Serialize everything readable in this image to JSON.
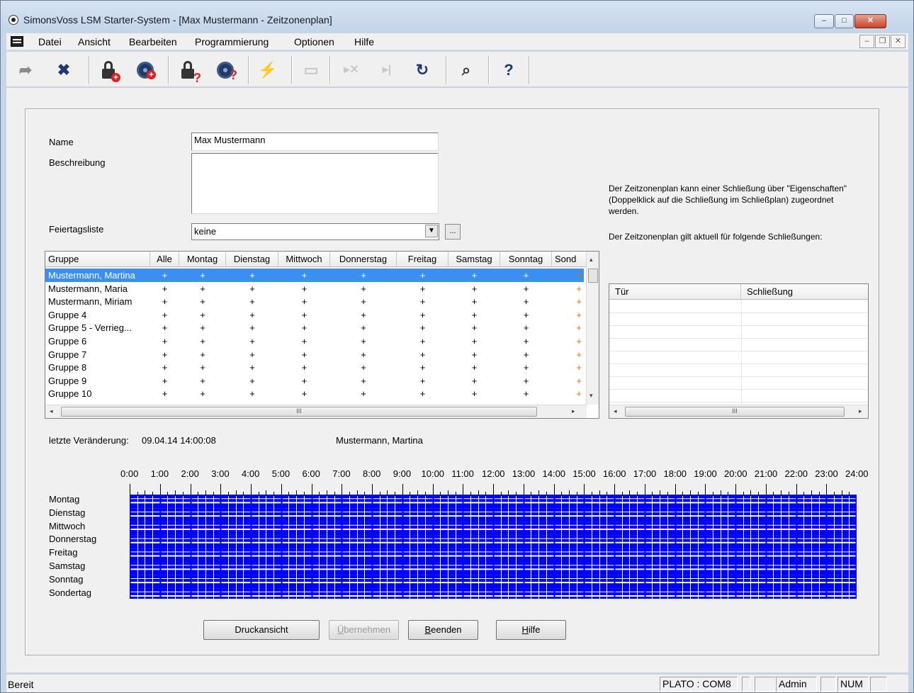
{
  "window": {
    "title": "SimonsVoss LSM Starter-System - [Max Mustermann - Zeitzonenplan]",
    "min_label": "–",
    "max_label": "□",
    "close_label": "✕"
  },
  "menu": {
    "items": [
      "Datei",
      "Ansicht",
      "Bearbeiten",
      "Programmierung",
      "Optionen",
      "Hilfe"
    ],
    "mdi_min": "–",
    "mdi_restore": "❐",
    "mdi_close": "✕"
  },
  "toolbar": {
    "icons": [
      "arrow-right-icon",
      "cross-arrows-icon",
      "add-lock-icon",
      "add-transponder-icon",
      "lock-query-icon",
      "transponder-query-icon",
      "lightning-icon",
      "save-icon",
      "delete-icon",
      "insert-icon",
      "refresh-icon",
      "search-icon",
      "help-icon"
    ],
    "arrow_glyph": "➦",
    "cross_glyph": "✖",
    "lightning_glyph": "⚡",
    "save_glyph": "▭",
    "delete_glyph": "▸✕",
    "insert_glyph": "▸|",
    "refresh_glyph": "↻",
    "search_glyph": "⌕",
    "help_glyph": "?"
  },
  "form": {
    "name_label": "Name",
    "name_value": "Max Mustermann",
    "desc_label": "Beschreibung",
    "desc_value": "",
    "holiday_label": "Feiertagsliste",
    "holiday_value": "keine",
    "holiday_button": "...",
    "info_text": "Der Zeitzonenplan kann einer Schließung über \"Eigenschaften\" (Doppelklick auf die Schließung im Schließplan) zugeordnet werden.",
    "info_text2": "Der Zeitzonenplan gilt aktuell für folgende Schließungen:"
  },
  "group_grid": {
    "columns": [
      "Gruppe",
      "Alle",
      "Montag",
      "Dienstag",
      "Mittwoch",
      "Donnerstag",
      "Freitag",
      "Samstag",
      "Sonntag",
      "Sond"
    ],
    "rows": [
      {
        "name": "Mustermann, Martina",
        "selected": true
      },
      {
        "name": "Mustermann, Maria",
        "selected": false
      },
      {
        "name": "Mustermann, Miriam",
        "selected": false
      },
      {
        "name": "Gruppe  4",
        "selected": false
      },
      {
        "name": "Gruppe  5 - Verrieg...",
        "selected": false
      },
      {
        "name": "Gruppe  6",
        "selected": false
      },
      {
        "name": "Gruppe  7",
        "selected": false
      },
      {
        "name": "Gruppe  8",
        "selected": false
      },
      {
        "name": "Gruppe  9",
        "selected": false
      },
      {
        "name": "Gruppe  10",
        "selected": false
      }
    ],
    "cell_value": "+"
  },
  "door_grid": {
    "columns": [
      "Tür",
      "Schließung"
    ]
  },
  "last_change": {
    "label": "letzte Veränderung:",
    "value": "09.04.14 14:00:08",
    "user": "Mustermann, Martina"
  },
  "timeline": {
    "hours": [
      "0:00",
      "1:00",
      "2:00",
      "3:00",
      "4:00",
      "5:00",
      "6:00",
      "7:00",
      "8:00",
      "9:00",
      "10:00",
      "11:00",
      "12:00",
      "13:00",
      "14:00",
      "15:00",
      "16:00",
      "17:00",
      "18:00",
      "19:00",
      "20:00",
      "21:00",
      "22:00",
      "23:00",
      "24:00"
    ],
    "days": [
      "Montag",
      "Dienstag",
      "Mittwoch",
      "Donnerstag",
      "Freitag",
      "Samstag",
      "Sonntag",
      "Sondertag"
    ],
    "fill_color": "#0000ff"
  },
  "buttons": {
    "print": "Druckansicht",
    "apply_u": "Ü",
    "apply_rest": "bernehmen",
    "close_u": "B",
    "close_rest": "eenden",
    "help_u": "H",
    "help_rest": "ilfe"
  },
  "status": {
    "text": "Bereit",
    "port": "PLATO : COM8",
    "user": "Admin",
    "num": "NUM"
  },
  "scroll": {
    "left": "◂",
    "right": "▸",
    "up": "▴",
    "down": "▾",
    "grip": "III"
  }
}
